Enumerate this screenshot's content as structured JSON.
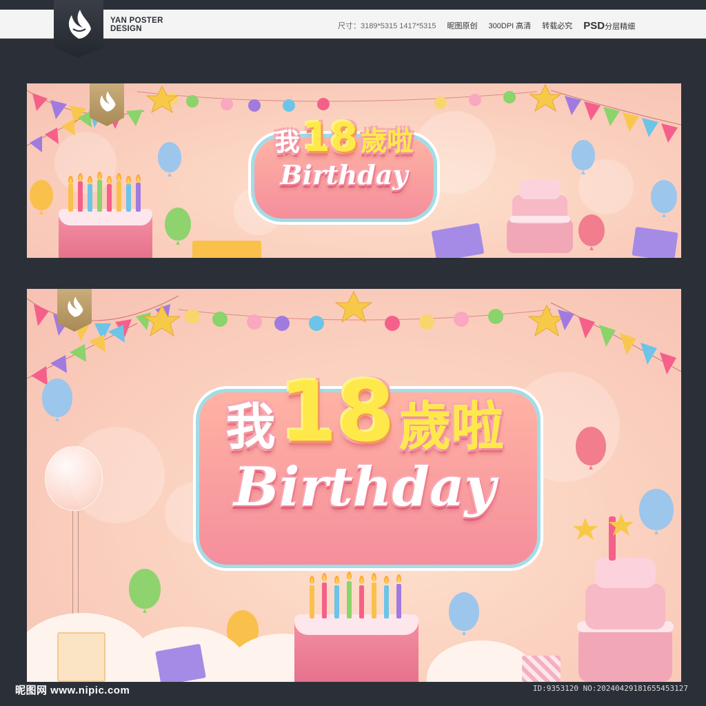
{
  "header": {
    "brand_line1": "YAN POSTER",
    "brand_line2": "DESIGN",
    "size_label": "尺寸：3189*5315  1417*5315",
    "original": "昵图原创",
    "dpi": "300DPI 高清",
    "copyright": "转载必究",
    "psd": "PSD",
    "layered": "分层精细"
  },
  "banner_small": {
    "title_cn_pre": "我",
    "title_num": "18",
    "title_cn_post": "歲啦",
    "title_en": "Birthday"
  },
  "banner_large": {
    "title_cn_pre": "我",
    "title_num": "18",
    "title_cn_post": "歲啦",
    "title_en": "Birthday"
  },
  "footer": {
    "watermark": "昵图网 www.nipic.com",
    "id_text": "ID:9353120 NO:20240429181655453127"
  },
  "colors": {
    "page_bg": "#2b3038",
    "banner_pink": "#fbd2c0",
    "title_yellow": "#ffe94a",
    "accent_pink": "#f58e9c",
    "accent_teal": "#9fdde8"
  }
}
